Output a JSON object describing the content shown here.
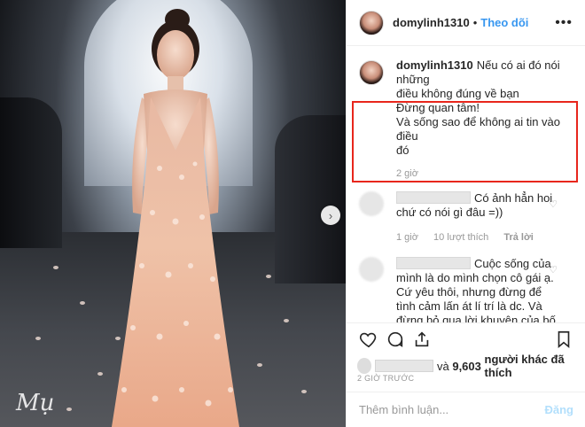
{
  "post": {
    "username": "domylinh1310",
    "follow_label": "Theo dõi",
    "separator": "•",
    "more_label": "•••",
    "signature": "Mụ"
  },
  "caption": {
    "username": "domylinh1310",
    "line1": "Nếu có ai đó nói những",
    "line2": "điều không đúng về bạn",
    "line3": "Đừng quan tâm!",
    "line4": "Và sống sao để không ai tin vào điều",
    "line5": "đó",
    "time": "2 giờ"
  },
  "comments": [
    {
      "text": "Có ảnh hẳn hoi chứ có nói gì đâu =))",
      "time": "1 giờ",
      "likes": "10 lượt thích",
      "reply": "Trả lời"
    },
    {
      "text": "Cuộc sống của mình là do mình chọn cô gái ạ. Cứ yêu thôi, nhưng đừng để tình cảm lấn át lí trí là dc. Và đừng bỏ qua lời khuyên của bố mẹ, ng thân. Họ là ng từng trải, và luôn muốn điều tốt đẹp nhất cho con"
    }
  ],
  "likes": {
    "and": "và",
    "count": "9,603",
    "suffix": "người khác đã thích"
  },
  "timestamp": "2 GIỜ TRƯỚC",
  "add_comment": {
    "placeholder": "Thêm bình luận...",
    "post_label": "Đăng"
  },
  "colors": {
    "accent": "#3897f0",
    "highlight": "#e8261c",
    "muted": "#999999"
  }
}
